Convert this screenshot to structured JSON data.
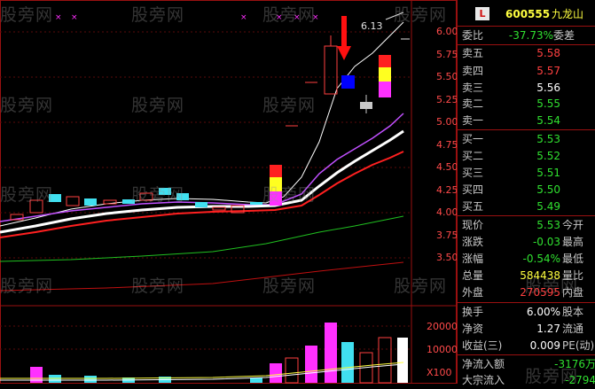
{
  "stock": {
    "code": "600555",
    "name": "九龙山",
    "logo_letter": "L"
  },
  "chart": {
    "price_ticks": [
      "6.00",
      "5.75",
      "5.50",
      "5.25",
      "5.00",
      "4.75",
      "4.50",
      "4.25",
      "4.00",
      "3.75",
      "3.50"
    ],
    "volume_ticks": [
      "20000",
      "10000",
      "X100"
    ],
    "annotation": "6.13",
    "watermark": "股旁网"
  },
  "panel": {
    "weibi": {
      "label": "委比",
      "value": "-37.73%",
      "label2": "委差"
    },
    "asks": [
      {
        "label": "卖五",
        "price": "5.58"
      },
      {
        "label": "卖四",
        "price": "5.57"
      },
      {
        "label": "卖三",
        "price": "5.56"
      },
      {
        "label": "卖二",
        "price": "5.55"
      },
      {
        "label": "卖一",
        "price": "5.54"
      }
    ],
    "bids": [
      {
        "label": "买一",
        "price": "5.53"
      },
      {
        "label": "买二",
        "price": "5.52"
      },
      {
        "label": "买三",
        "price": "5.51"
      },
      {
        "label": "买四",
        "price": "5.50"
      },
      {
        "label": "买五",
        "price": "5.49"
      }
    ],
    "quote": [
      {
        "label": "现价",
        "value": "5.53",
        "label2": "今开"
      },
      {
        "label": "涨跌",
        "value": "-0.03",
        "label2": "最高"
      },
      {
        "label": "涨幅",
        "value": "-0.54%",
        "label2": "最低"
      },
      {
        "label": "总量",
        "value": "584438",
        "label2": "量比"
      },
      {
        "label": "外盘",
        "value": "270595",
        "label2": "内盘"
      }
    ],
    "stats": [
      {
        "label": "换手",
        "value": "6.00%",
        "label2": "股本"
      },
      {
        "label": "净资",
        "value": "1.27",
        "label2": "流通"
      },
      {
        "label": "收益(三)",
        "value": "0.009",
        "label2": "PE(动)"
      }
    ],
    "flows": [
      {
        "label": "净流入额",
        "value": "-3176万"
      },
      {
        "label": "大宗流入",
        "value": "-2794"
      }
    ]
  }
}
